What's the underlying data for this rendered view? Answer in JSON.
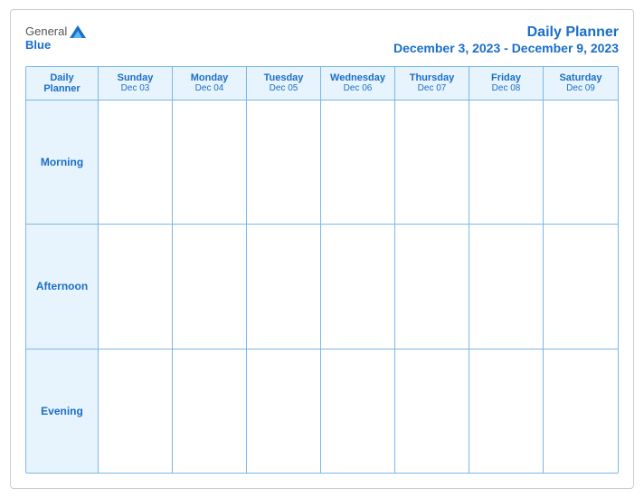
{
  "logo": {
    "general": "General",
    "blue": "Blue"
  },
  "header": {
    "title": "Daily Planner",
    "date_range": "December 3, 2023 - December 9, 2023"
  },
  "calendar": {
    "label": {
      "line1": "Daily",
      "line2": "Planner"
    },
    "days": [
      {
        "name": "Sunday",
        "date": "Dec 03"
      },
      {
        "name": "Monday",
        "date": "Dec 04"
      },
      {
        "name": "Tuesday",
        "date": "Dec 05"
      },
      {
        "name": "Wednesday",
        "date": "Dec 06"
      },
      {
        "name": "Thursday",
        "date": "Dec 07"
      },
      {
        "name": "Friday",
        "date": "Dec 08"
      },
      {
        "name": "Saturday",
        "date": "Dec 09"
      }
    ],
    "rows": [
      {
        "label": "Morning"
      },
      {
        "label": "Afternoon"
      },
      {
        "label": "Evening"
      }
    ]
  }
}
